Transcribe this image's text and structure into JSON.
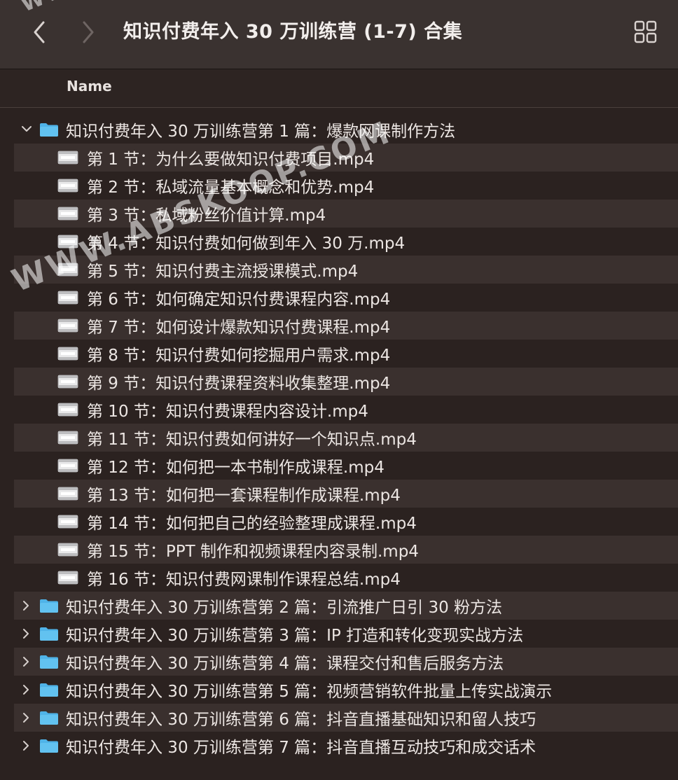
{
  "window": {
    "title": "知识付费年入 30 万训练营 (1-7) 合集",
    "back_icon": "chevron-left-icon",
    "forward_icon": "chevron-right-icon",
    "view_icon": "grid-view-icon"
  },
  "columns": {
    "name": "Name"
  },
  "colors": {
    "folder": "#4fb3e8",
    "background": "#2b2220",
    "row_alt": "#3a302e"
  },
  "watermark": "WWW.ABSKOOP.COM",
  "watermark_top": "WWW",
  "folders": [
    {
      "label": "知识付费年入 30 万训练营第 1 篇：爆款网课制作方法",
      "expanded": true,
      "files": [
        "第 1 节：为什么要做知识付费项目.mp4",
        "第 2 节：私域流量基本概念和优势.mp4",
        "第 3 节：私域粉丝价值计算.mp4",
        "第 4 节：知识付费如何做到年入 30 万.mp4",
        "第 5 节：知识付费主流授课模式.mp4",
        "第 6 节：如何确定知识付费课程内容.mp4",
        "第 7 节：如何设计爆款知识付费课程.mp4",
        "第 8 节：知识付费如何挖掘用户需求.mp4",
        "第 9 节：知识付费课程资料收集整理.mp4",
        "第 10 节：知识付费课程内容设计.mp4",
        "第 11 节：知识付费如何讲好一个知识点.mp4",
        "第 12 节：如何把一本书制作成课程.mp4",
        "第 13 节：如何把一套课程制作成课程.mp4",
        "第 14 节：如何把自己的经验整理成课程.mp4",
        "第 15 节：PPT 制作和视频课程内容录制.mp4",
        "第 16 节：知识付费网课制作课程总结.mp4"
      ]
    },
    {
      "label": "知识付费年入 30 万训练营第 2 篇：引流推广日引 30 粉方法",
      "expanded": false
    },
    {
      "label": "知识付费年入 30 万训练营第 3 篇：IP 打造和转化变现实战方法",
      "expanded": false
    },
    {
      "label": "知识付费年入 30 万训练营第 4 篇：课程交付和售后服务方法",
      "expanded": false
    },
    {
      "label": "知识付费年入 30 万训练营第 5 篇：视频营销软件批量上传实战演示",
      "expanded": false
    },
    {
      "label": "知识付费年入 30 万训练营第 6 篇：抖音直播基础知识和留人技巧",
      "expanded": false
    },
    {
      "label": "知识付费年入 30 万训练营第 7 篇：抖音直播互动技巧和成交话术",
      "expanded": false
    }
  ]
}
